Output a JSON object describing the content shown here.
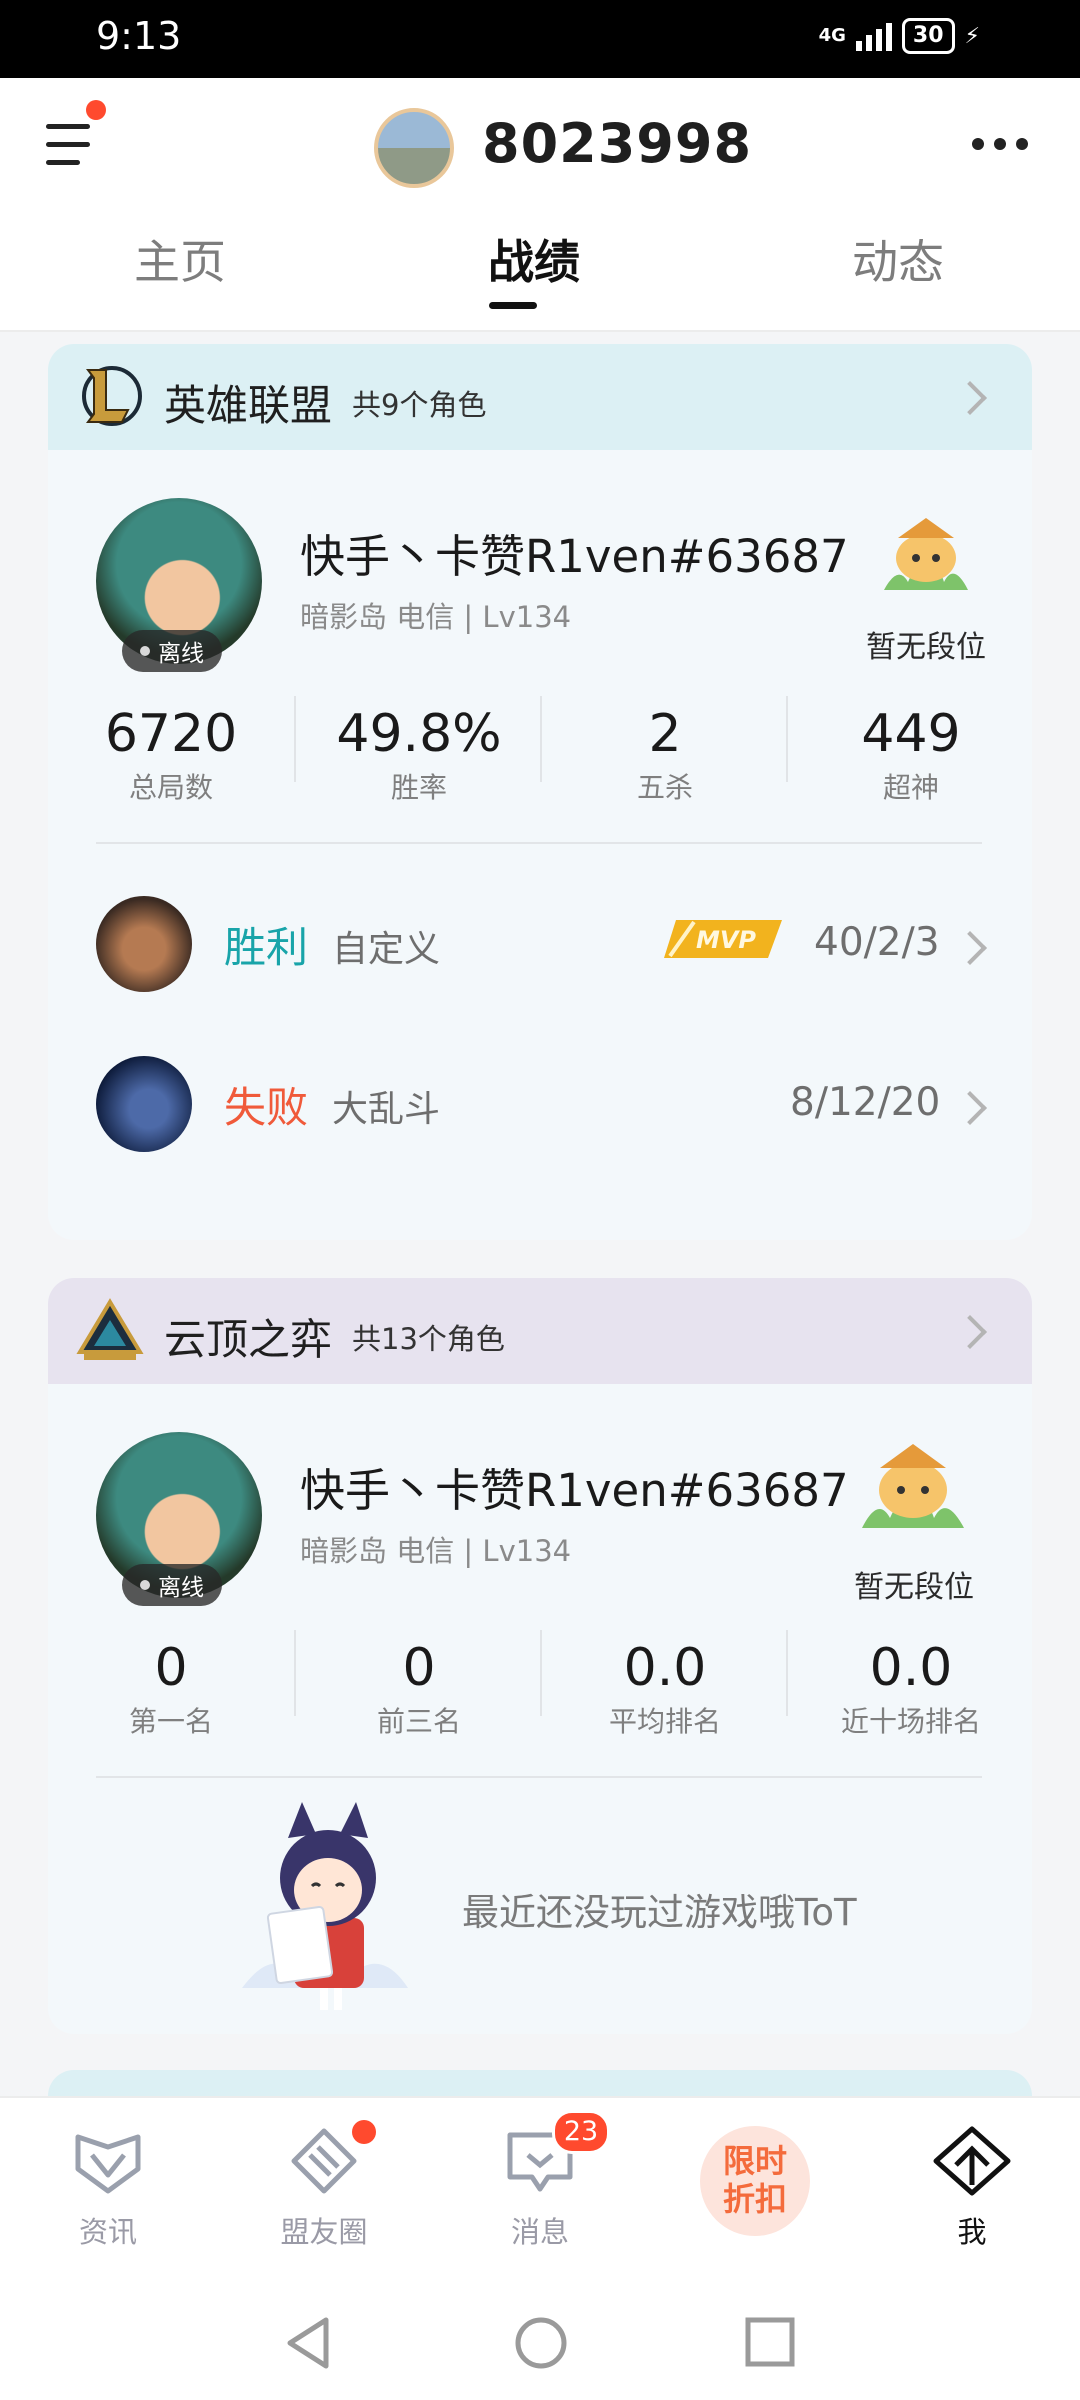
{
  "status_bar": {
    "time": "9:13",
    "network": "4G",
    "battery": "30"
  },
  "header": {
    "user_id": "8023998"
  },
  "tabs": [
    {
      "label": "主页",
      "active": false
    },
    {
      "label": "战绩",
      "active": true
    },
    {
      "label": "动态",
      "active": false
    }
  ],
  "lol": {
    "game_name": "英雄联盟",
    "roles": "共9个角色",
    "player_name": "快手丶卡赞R1ven#63687",
    "player_info": "暗影岛 电信 | Lv134",
    "status": "离线",
    "rank": "暂无段位",
    "stats": [
      {
        "value": "6720",
        "label": "总局数"
      },
      {
        "value": "49.8%",
        "label": "胜率"
      },
      {
        "value": "2",
        "label": "五杀"
      },
      {
        "value": "449",
        "label": "超神"
      }
    ],
    "matches": [
      {
        "result": "胜利",
        "mode": "自定义",
        "mvp": "MVP",
        "kda": "40/2/3"
      },
      {
        "result": "失败",
        "mode": "大乱斗",
        "kda": "8/12/20"
      }
    ]
  },
  "tft": {
    "game_name": "云顶之弈",
    "roles": "共13个角色",
    "player_name": "快手丶卡赞R1ven#63687",
    "player_info": "暗影岛 电信 | Lv134",
    "status": "离线",
    "rank": "暂无段位",
    "stats": [
      {
        "value": "0",
        "label": "第一名"
      },
      {
        "value": "0",
        "label": "前三名"
      },
      {
        "value": "0.0",
        "label": "平均排名"
      },
      {
        "value": "0.0",
        "label": "近十场排名"
      }
    ],
    "empty_message": "最近还没玩过游戏哦ToT"
  },
  "bottom_nav": [
    {
      "label": "资讯",
      "icon": "news-icon"
    },
    {
      "label": "盟友圈",
      "icon": "friends-circle-icon"
    },
    {
      "label": "消息",
      "icon": "message-icon",
      "badge": "23"
    },
    {
      "label": "限时折扣",
      "icon": "discount-badge"
    },
    {
      "label": "我",
      "icon": "me-icon",
      "active": true
    }
  ],
  "colors": {
    "win": "#18a4a9",
    "lose": "#f05a3a",
    "badge": "#ff4a2e",
    "accent": "#d3e6ec"
  }
}
